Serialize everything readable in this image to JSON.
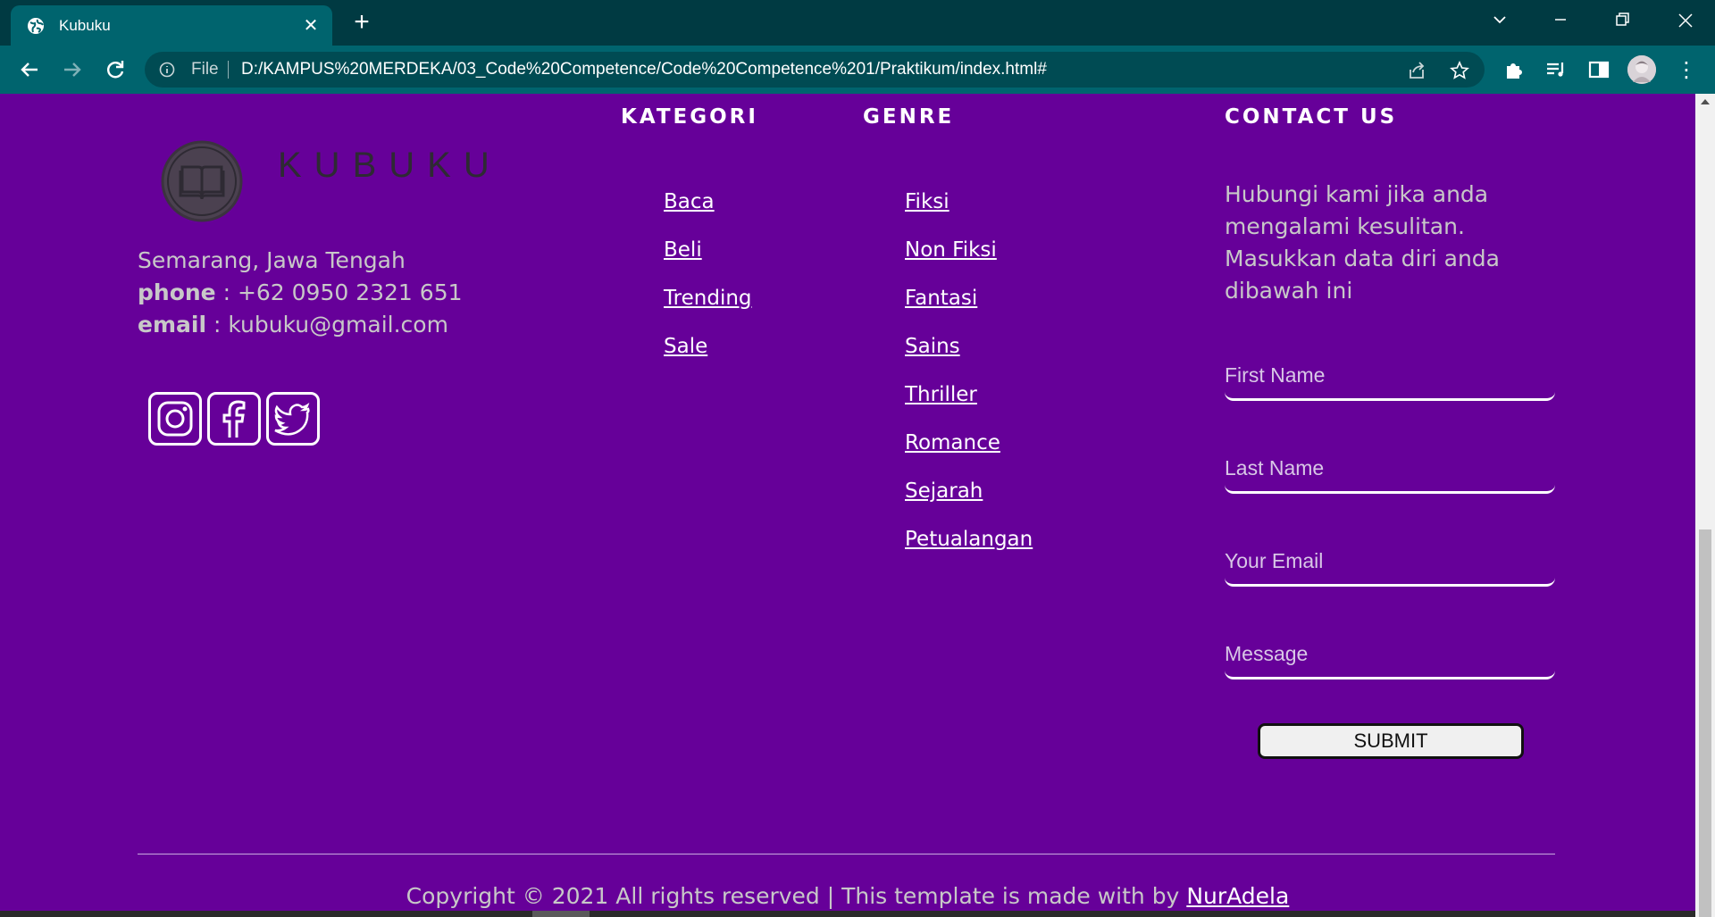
{
  "browser": {
    "tab_title": "Kubuku",
    "new_tab_label": "+",
    "file_label": "File",
    "url": "D:/KAMPUS%20MERDEKA/03_Code%20Competence/Code%20Competence%201/Praktikum/index.html#",
    "menu_label": "⋮"
  },
  "footer": {
    "brand": "KUBUKU",
    "address": "Semarang, Jawa Tengah",
    "phone_label": "phone",
    "phone_value": " : +62 0950 2321 651",
    "email_label": "email",
    "email_value": " : kubuku@gmail.com",
    "social": [
      "instagram-icon",
      "facebook-icon",
      "twitter-icon"
    ],
    "kategori": {
      "heading": "KATEGORI",
      "items": [
        "Baca",
        "Beli",
        "Trending",
        "Sale"
      ]
    },
    "genre": {
      "heading": "GENRE",
      "items": [
        "Fiksi",
        "Non Fiksi",
        "Fantasi",
        "Sains",
        "Thriller",
        "Romance",
        "Sejarah",
        "Petualangan"
      ]
    },
    "contact": {
      "heading": "CONTACT US",
      "text": "Hubungi kami jika anda mengalami kesulitan. Masukkan data diri anda dibawah ini",
      "first_name_placeholder": "First Name",
      "last_name_placeholder": "Last Name",
      "email_placeholder": "Your Email",
      "message_placeholder": "Message",
      "submit_label": "SUBMIT"
    },
    "copyright_text": "Copyright © 2021 All rights reserved | This template is made with by ",
    "copyright_author": "NurAdela"
  },
  "colors": {
    "page_bg": "#660099",
    "tabbar_bg": "#003a42",
    "toolbar_bg": "#00646e",
    "text_muted": "#c8c8c8"
  }
}
